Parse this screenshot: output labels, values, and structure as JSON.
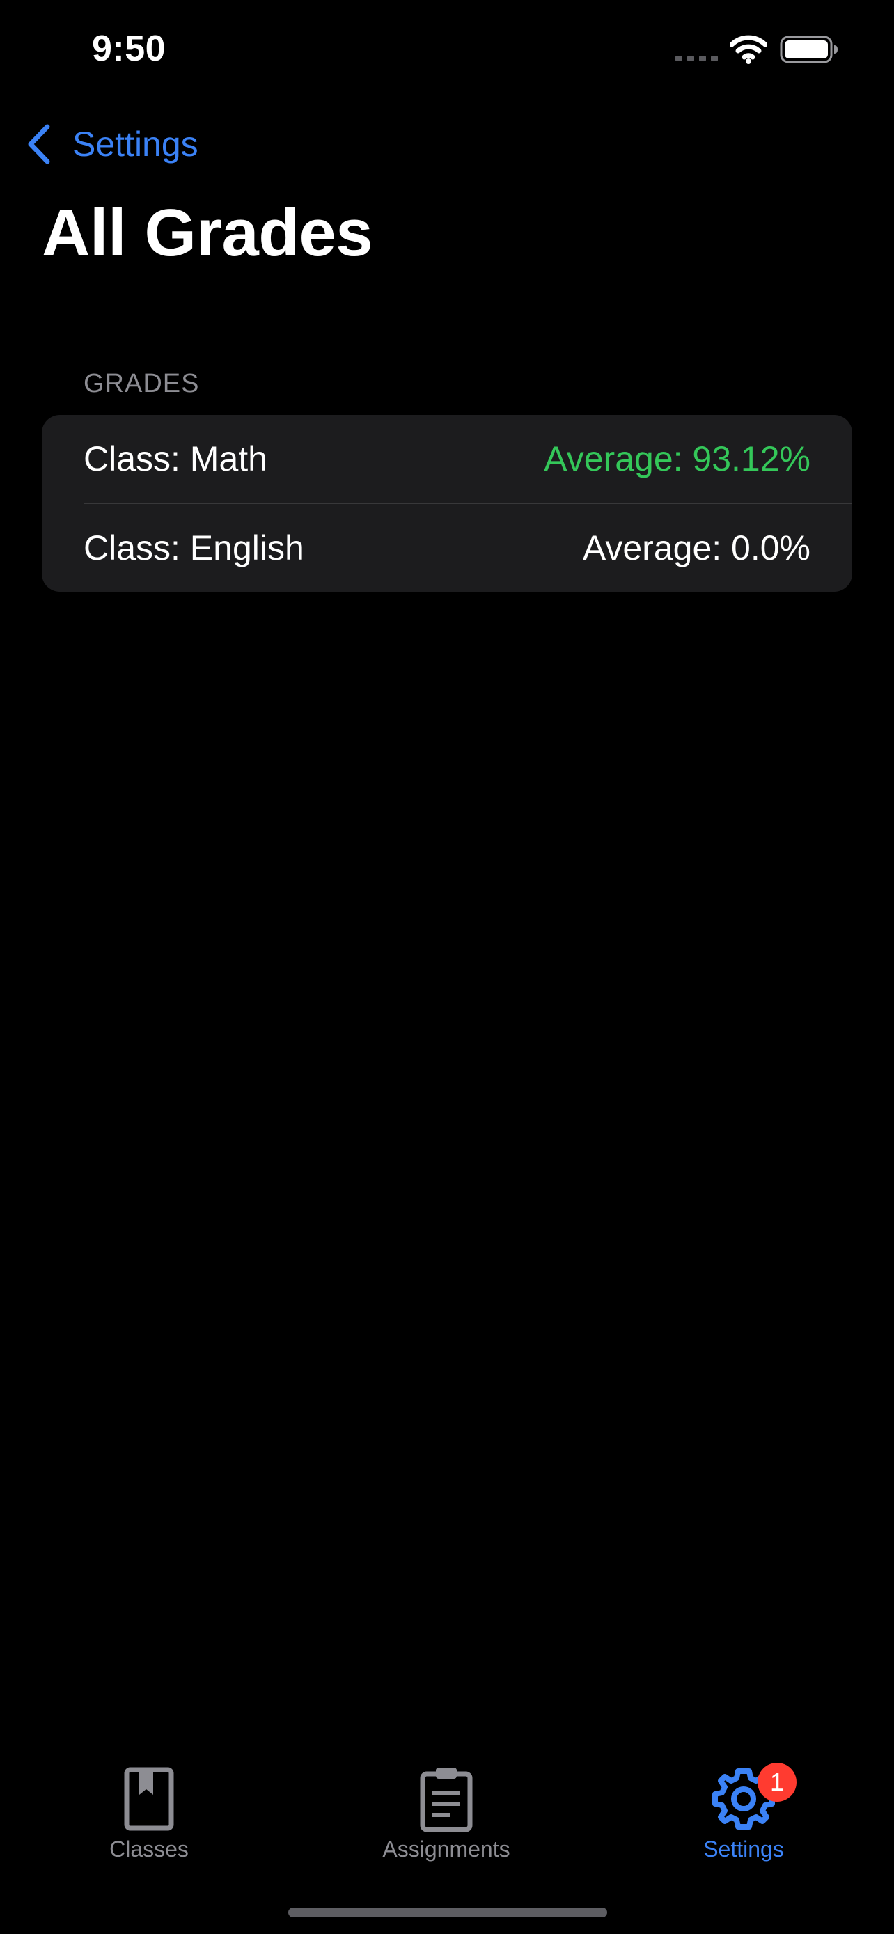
{
  "status_bar": {
    "time": "9:50"
  },
  "nav": {
    "back_label": "Settings",
    "title": "All Grades"
  },
  "grades_section": {
    "header": "GRADES",
    "rows": [
      {
        "class_label": "Class: Math",
        "average_label": "Average: 93.12%",
        "average_color": "#34c759"
      },
      {
        "class_label": "Class: English",
        "average_label": "Average: 0.0%",
        "average_color": "#ffffff"
      }
    ]
  },
  "tab_bar": {
    "tabs": [
      {
        "label": "Classes",
        "icon": "book-icon",
        "active": false
      },
      {
        "label": "Assignments",
        "icon": "clipboard-icon",
        "active": false
      },
      {
        "label": "Settings",
        "icon": "gear-icon",
        "active": true,
        "badge": "1"
      }
    ]
  },
  "colors": {
    "accent": "#3b82f6",
    "background": "#000000",
    "card": "#1c1c1e",
    "secondary_text": "#8d8d93",
    "success": "#34c759",
    "badge": "#ff3b30"
  }
}
